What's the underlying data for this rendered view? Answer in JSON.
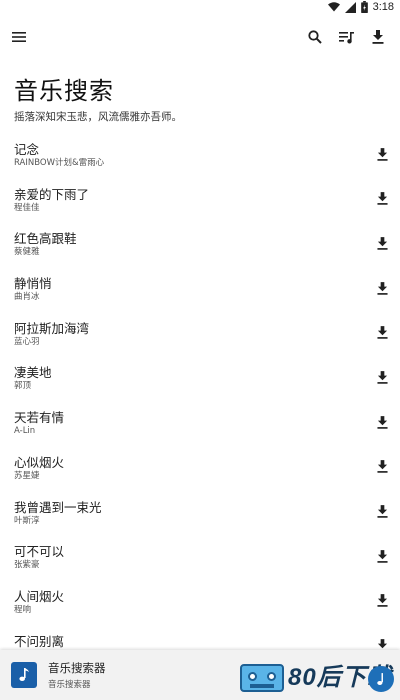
{
  "status_bar": {
    "time": "3:18"
  },
  "toolbar": {
    "menu_icon": "menu-icon",
    "search_icon": "search-icon",
    "playlist_icon": "playlist-icon",
    "download_icon": "download-icon"
  },
  "header": {
    "title": "音乐搜索",
    "subtitle": "摇落深知宋玉悲，风流儒雅亦吾师。"
  },
  "songs": [
    {
      "title": "记念",
      "artist": "RAINBOW计划&雷雨心"
    },
    {
      "title": "亲爱的下雨了",
      "artist": "程佳佳"
    },
    {
      "title": "红色高跟鞋",
      "artist": "蔡健雅"
    },
    {
      "title": "静悄悄",
      "artist": "曲肖冰"
    },
    {
      "title": "阿拉斯加海湾",
      "artist": "蓝心羽"
    },
    {
      "title": "凄美地",
      "artist": "郭顶"
    },
    {
      "title": "天若有情",
      "artist": "A-Lin"
    },
    {
      "title": "心似烟火",
      "artist": "苏星婕"
    },
    {
      "title": "我曾遇到一束光",
      "artist": "叶斯淳"
    },
    {
      "title": "可不可以",
      "artist": "张紫豪"
    },
    {
      "title": "人间烟火",
      "artist": "程响"
    },
    {
      "title": "不问别离",
      "artist": ""
    }
  ],
  "player": {
    "title": "音乐搜索器",
    "subtitle": "音乐搜索器"
  },
  "watermark": {
    "text": "80后下载"
  },
  "colors": {
    "accent": "#1a5fa8",
    "icon": "#212121",
    "player_bg": "#f2f2f2"
  }
}
